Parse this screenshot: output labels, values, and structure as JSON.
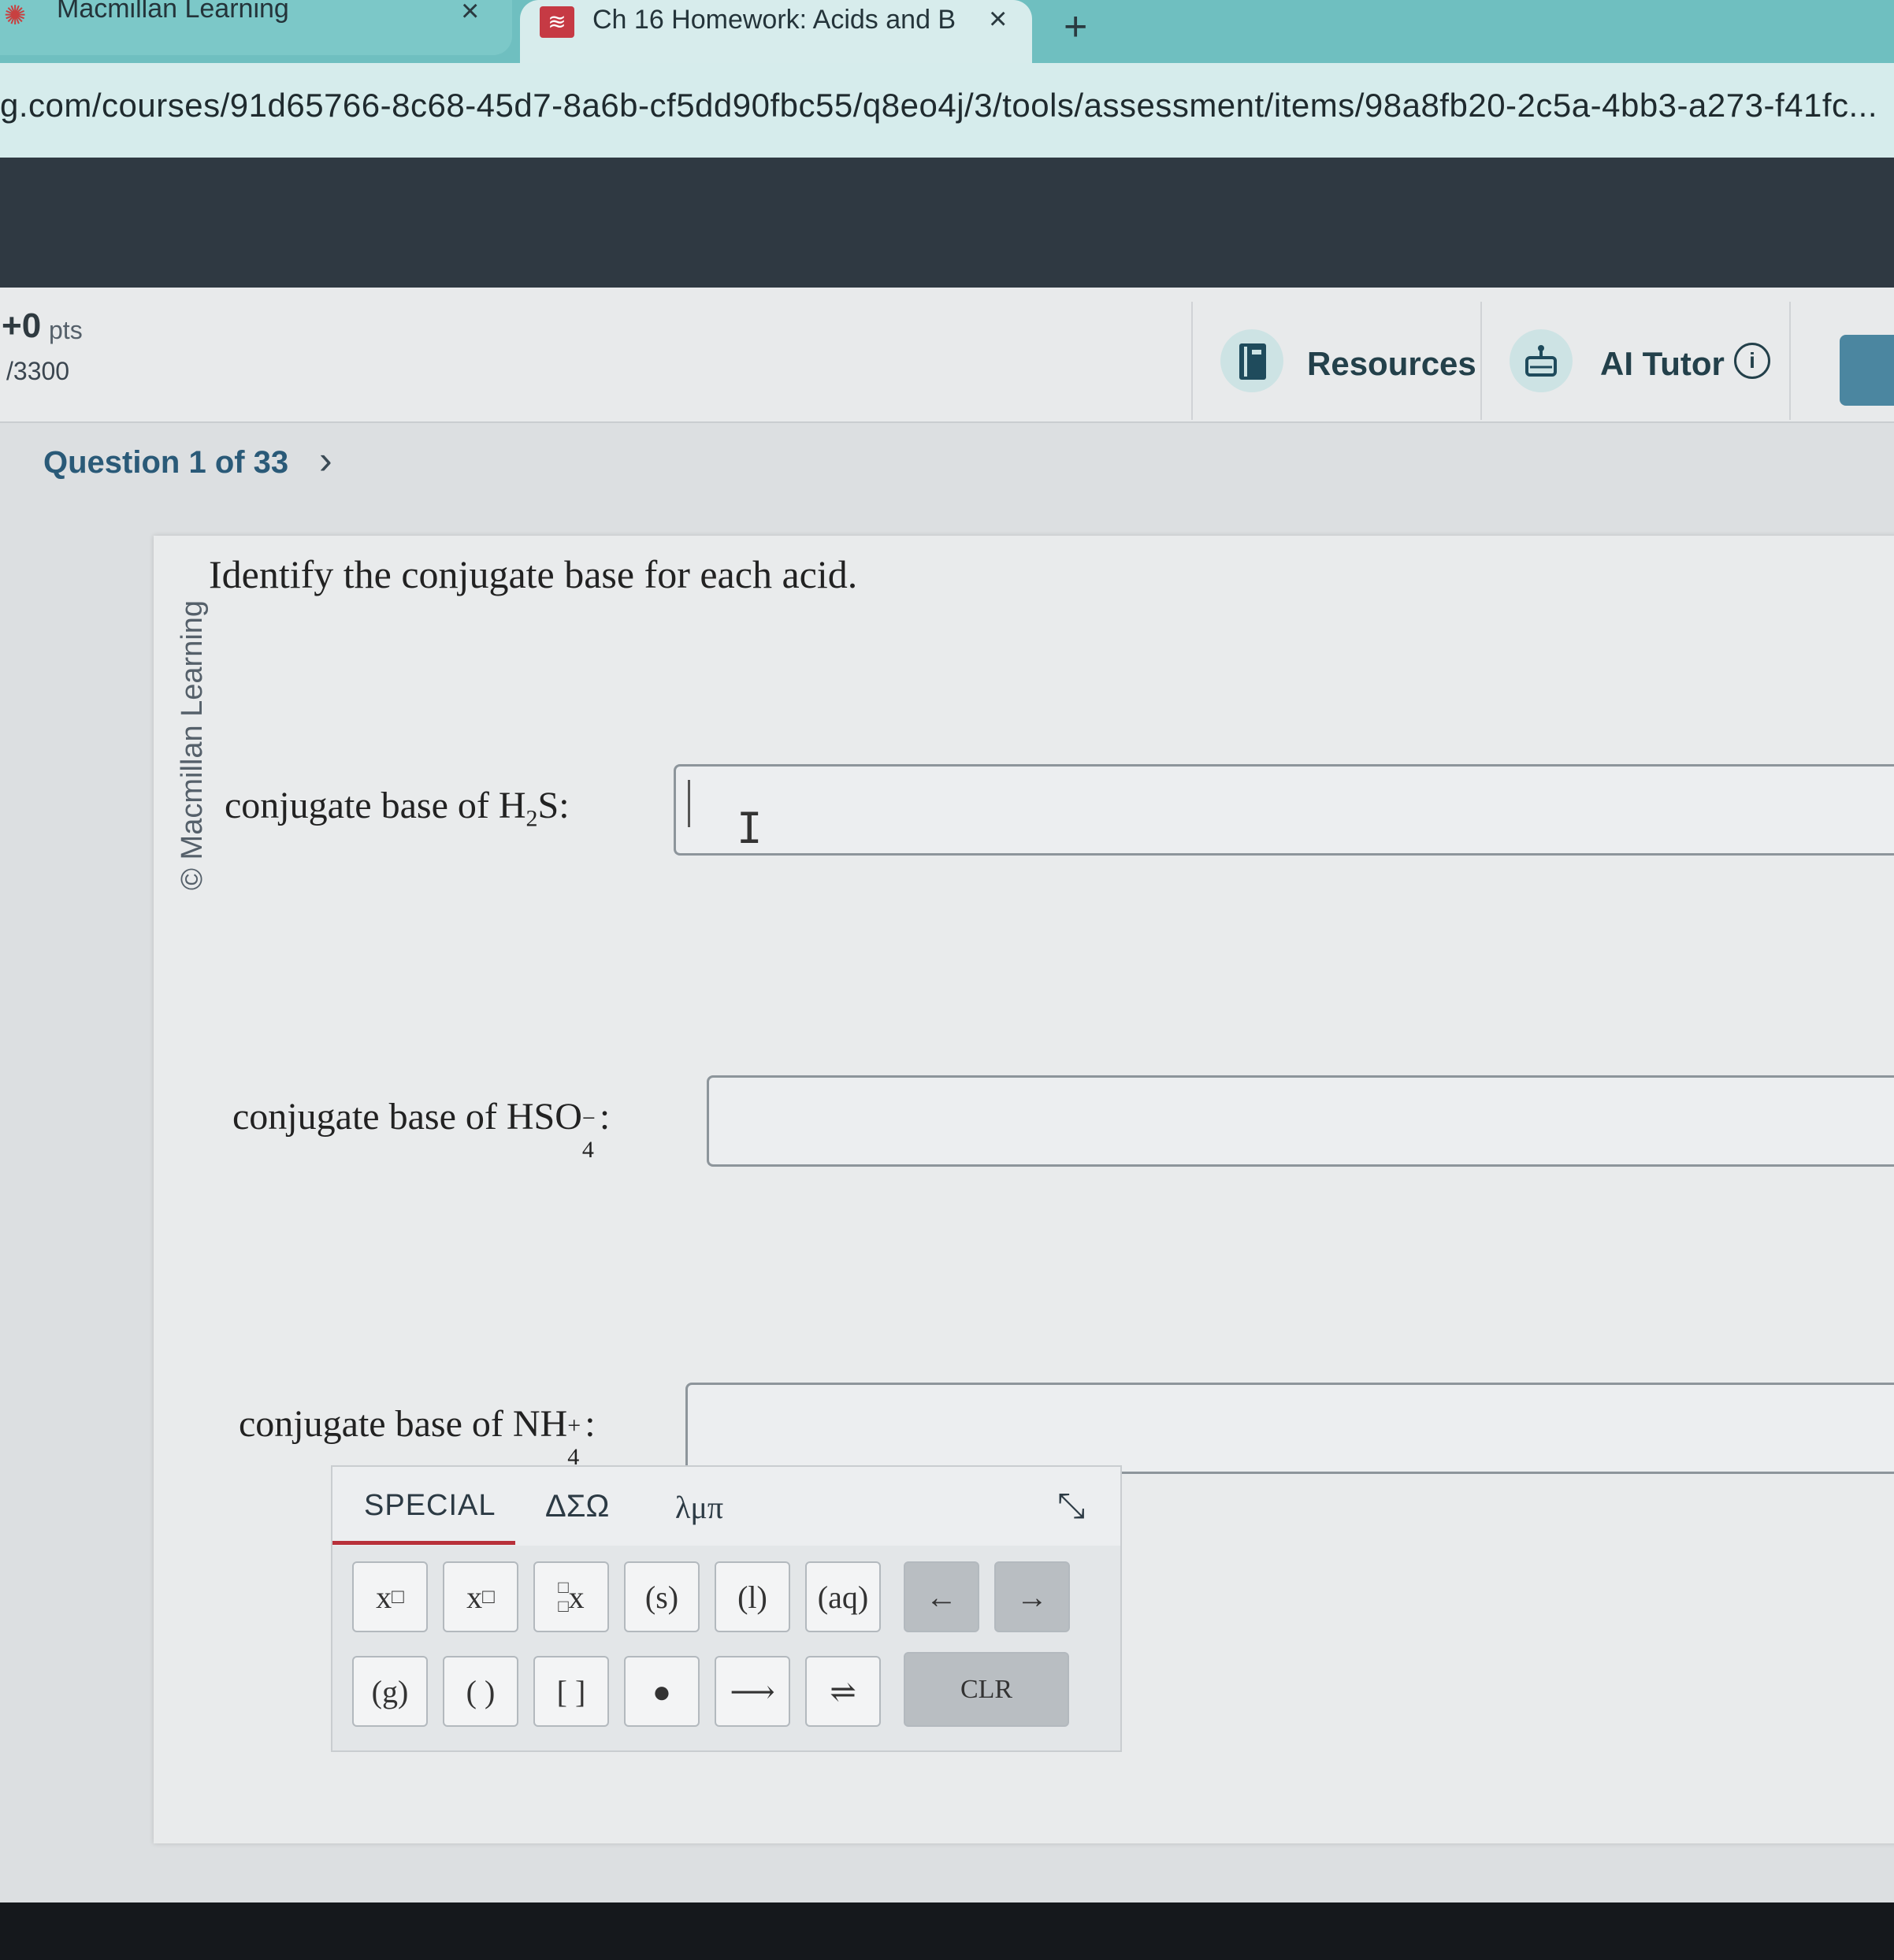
{
  "browser": {
    "tabs": [
      {
        "title": "Macmillan Learning",
        "close": "×"
      },
      {
        "title": "Ch 16 Homework: Acids and B",
        "close": "×"
      }
    ],
    "new_tab": "+",
    "url": "g.com/courses/91d65766-8c68-45d7-8a6b-cf5dd90fbc55/q8eo4j/3/tools/assessment/items/98a8fb20-2c5a-4bb3-a273-f41fc..."
  },
  "header": {
    "points": "+0",
    "points_word": "pts",
    "total": "/3300",
    "resources_label": "Resources",
    "ai_tutor_label": "AI Tutor",
    "info_glyph": "i"
  },
  "nav": {
    "question_label": "Question 1 of 33",
    "next_glyph": "›"
  },
  "question": {
    "copyright": "© Macmillan Learning",
    "prompt": "Identify the conjugate base for each acid.",
    "items": [
      {
        "pre": "conjugate base of H",
        "sub": "2",
        "post": "S:",
        "value": ""
      },
      {
        "pre": "conjugate base of HSO",
        "sub": "4",
        "sup": "−",
        "post": ":",
        "value": ""
      },
      {
        "pre": "conjugate base of NH",
        "sub": "4",
        "sup": "+",
        "post": ":",
        "value": ""
      }
    ]
  },
  "keypad": {
    "tabs": [
      "SPECIAL",
      "ΔΣΩ",
      "λμπ"
    ],
    "active_tab": "SPECIAL",
    "collapse_glyph": "⤡",
    "row1": [
      "x□",
      "x□",
      "□x",
      "(s)",
      "(l)",
      "(aq)",
      "←",
      "→"
    ],
    "row2": [
      "(g)",
      "( )",
      "[ ]",
      "●",
      "⟶",
      "⇌"
    ],
    "clear": "CLR"
  },
  "colors": {
    "tab_bar": "#6fbfc0",
    "accent_underline": "#b8303a",
    "nav_text": "#2a5a78"
  }
}
